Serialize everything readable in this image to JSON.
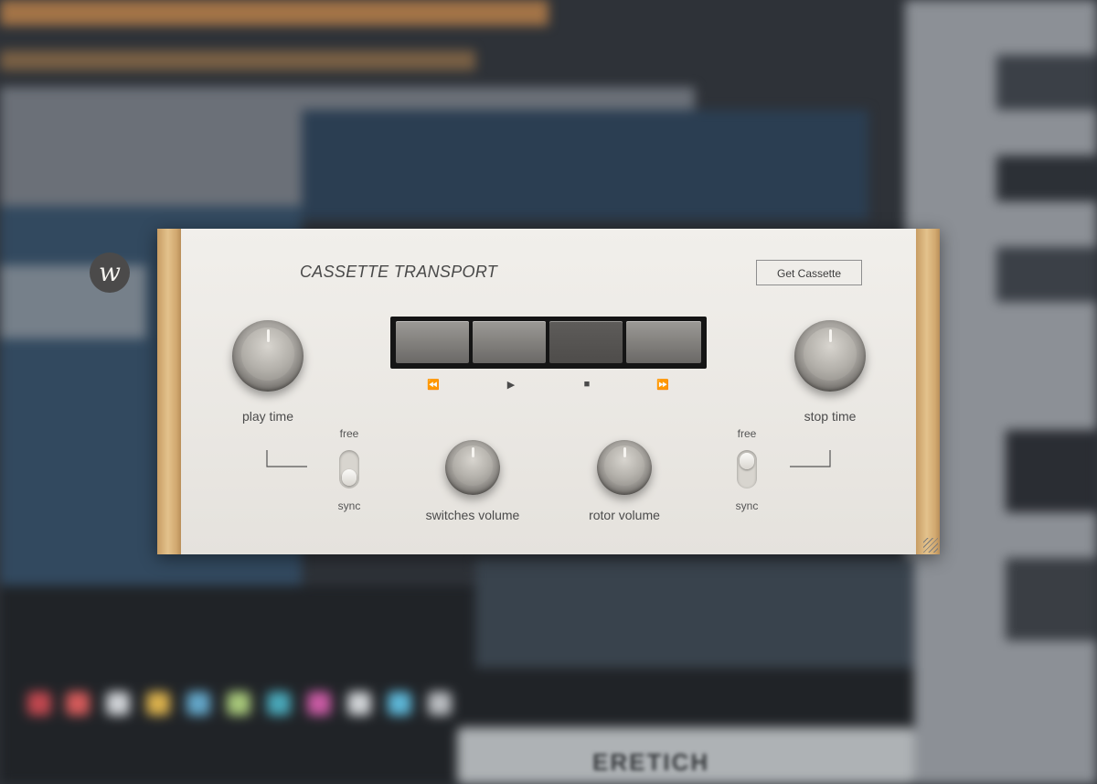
{
  "plugin": {
    "logo_letter": "w",
    "title": "CASSETTE TRANSPORT",
    "get_button": "Get Cassette",
    "knobs": {
      "play_time": "play time",
      "stop_time": "stop time",
      "switches_volume": "switches volume",
      "rotor_volume": "rotor volume"
    },
    "transport": {
      "rewind_icon": "⏪",
      "play_icon": "▶",
      "stop_icon": "■",
      "fast_forward_icon": "⏩",
      "pressed_button": "stop"
    },
    "left_toggle": {
      "top_label": "free",
      "bottom_label": "sync",
      "state": "sync"
    },
    "right_toggle": {
      "top_label": "free",
      "bottom_label": "sync",
      "state": "free"
    }
  },
  "background": {
    "footer_text": "ERETICH"
  },
  "colors": {
    "panel": "#eae7e2",
    "wood": "#d6b27a",
    "text": "#4b4b4b",
    "transport_frame": "#151515"
  }
}
